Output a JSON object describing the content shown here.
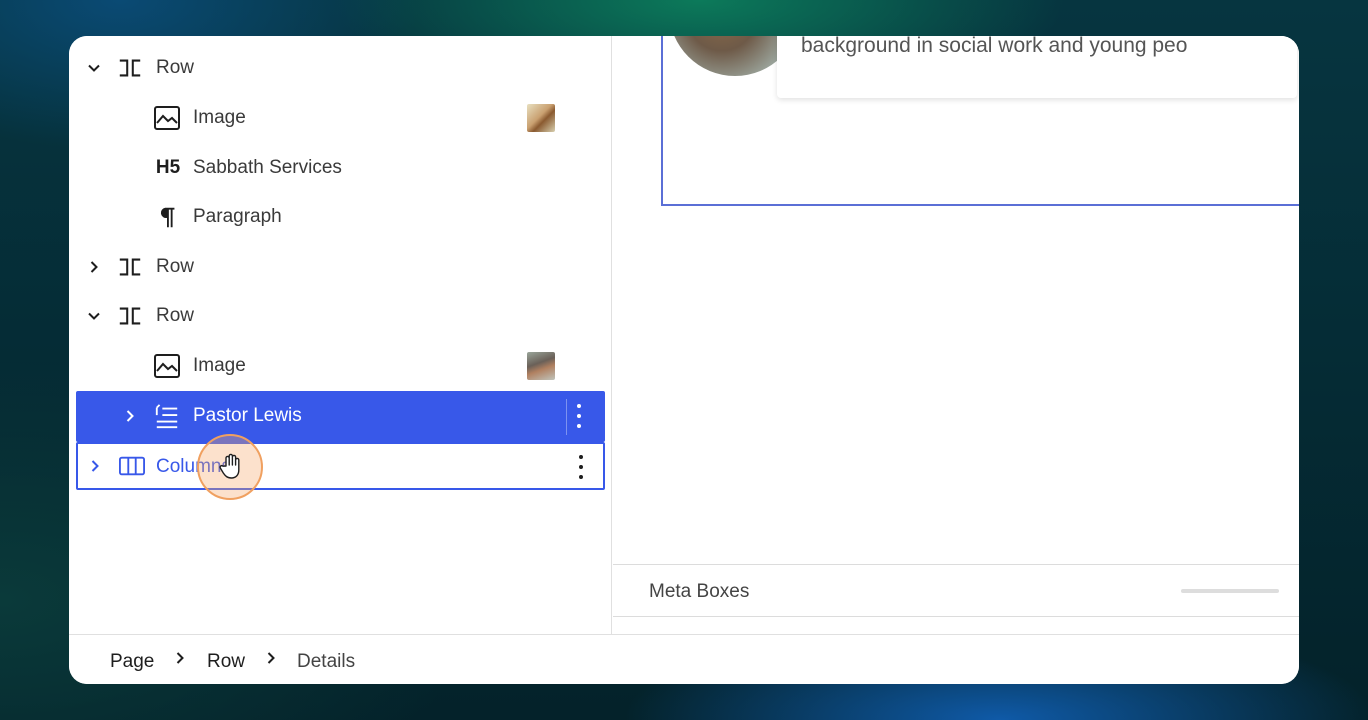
{
  "list_view": {
    "items": [
      {
        "label": "Row",
        "icon": "row-icon",
        "expanded": true
      },
      {
        "label": "Image",
        "icon": "image-icon"
      },
      {
        "label": "Sabbath Services",
        "icon": "heading-h5-icon",
        "icon_text": "H5"
      },
      {
        "label": "Paragraph",
        "icon": "paragraph-icon"
      },
      {
        "label": "Row",
        "icon": "row-icon",
        "expanded": false
      },
      {
        "label": "Row",
        "icon": "row-icon",
        "expanded": true
      },
      {
        "label": "Image",
        "icon": "image-icon"
      },
      {
        "label": "Pastor Lewis",
        "icon": "list-icon",
        "selected": true
      },
      {
        "label": "Columns",
        "icon": "columns-icon",
        "hovered": true
      }
    ]
  },
  "canvas": {
    "card_text": "background in social work and young peo"
  },
  "meta_boxes": {
    "label": "Meta Boxes"
  },
  "breadcrumb": {
    "items": [
      "Page",
      "Row",
      "Details"
    ]
  },
  "colors": {
    "accent": "#3858e9",
    "frame": "#5b6fd6",
    "cursor": "#f0a060"
  }
}
